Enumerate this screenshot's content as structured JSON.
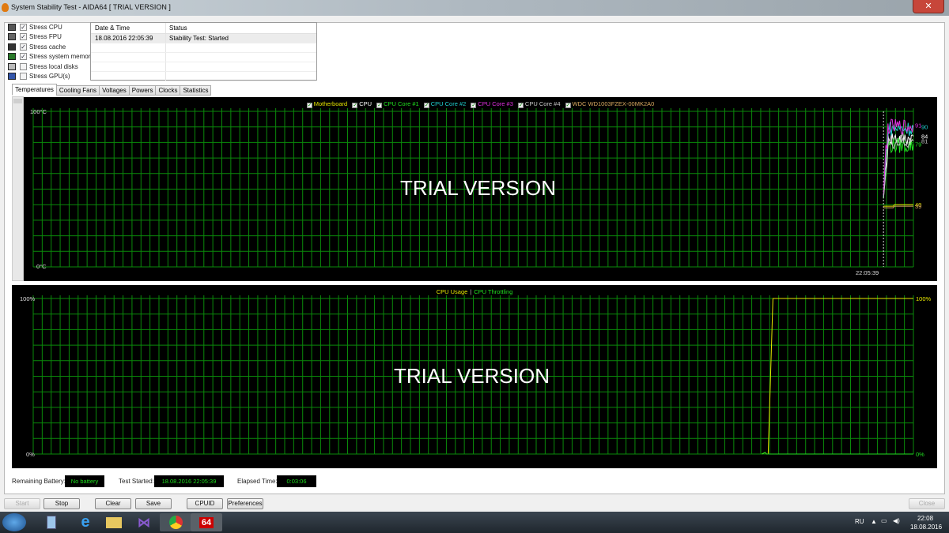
{
  "window": {
    "title": "System Stability Test - AIDA64  [ TRIAL VERSION ]",
    "close": "✕"
  },
  "stress": [
    {
      "label": "Stress CPU",
      "checked": true
    },
    {
      "label": "Stress FPU",
      "checked": true
    },
    {
      "label": "Stress cache",
      "checked": true
    },
    {
      "label": "Stress system memory",
      "checked": true
    },
    {
      "label": "Stress local disks",
      "checked": false
    },
    {
      "label": "Stress GPU(s)",
      "checked": false
    }
  ],
  "log": {
    "columns": [
      "Date & Time",
      "Status"
    ],
    "rows": [
      {
        "time": "18.08.2016 22:05:39",
        "status": "Stability Test: Started"
      }
    ]
  },
  "tabs": [
    "Temperatures",
    "Cooling Fans",
    "Voltages",
    "Powers",
    "Clocks",
    "Statistics"
  ],
  "watermark": "TRIAL VERSION",
  "chart_data": [
    {
      "type": "line",
      "title": "Temperatures",
      "ylim": [
        0,
        100
      ],
      "y_top_label": "100°C",
      "y_bottom_label": "0°C",
      "x_marker_label": "22:05:39",
      "grid": true,
      "legend": "top-center",
      "series": [
        {
          "name": "Motherboard",
          "color": "#e8e800",
          "idle": 39,
          "final": 40
        },
        {
          "name": "CPU",
          "color": "#ffffff",
          "idle": 45,
          "final": 84
        },
        {
          "name": "CPU Core #1",
          "color": "#20e020",
          "idle": 44,
          "final": 79
        },
        {
          "name": "CPU Core #2",
          "color": "#20d0d0",
          "idle": 45,
          "final": 90
        },
        {
          "name": "CPU Core #3",
          "color": "#e030e0",
          "idle": 46,
          "final": 91
        },
        {
          "name": "CPU Core #4",
          "color": "#c8c8c8",
          "idle": 44,
          "final": 81
        },
        {
          "name": "WDC WD1003FZEX-00MK2A0",
          "color": "#d8a860",
          "idle": 38,
          "final": 39
        }
      ]
    },
    {
      "type": "line",
      "title": "CPU Usage",
      "ylim": [
        0,
        100
      ],
      "y_top_label": "100%",
      "y_bottom_label": "0%",
      "right_top_label": "100%",
      "right_bottom_label": "0%",
      "grid": true,
      "legend": "top-center",
      "series": [
        {
          "name": "CPU Usage",
          "color": "#e8e800",
          "idle": 0,
          "final": 100
        },
        {
          "name": "CPU Throttling",
          "color": "#20e020",
          "idle": 0,
          "final": 0
        }
      ]
    }
  ],
  "status": {
    "battery_label": "Remaining Battery:",
    "battery": "No battery",
    "started_label": "Test Started:",
    "started": "18.08.2016 22:05:39",
    "elapsed_label": "Elapsed Time:",
    "elapsed": "0:03:06"
  },
  "buttons": {
    "start": "Start",
    "stop": "Stop",
    "clear": "Clear",
    "save": "Save",
    "cpuid": "CPUID",
    "preferences": "Preferences",
    "close": "Close"
  },
  "taskbar": {
    "aida": "64",
    "lang": "RU",
    "time": "22:08",
    "date": "18.08.2016"
  }
}
